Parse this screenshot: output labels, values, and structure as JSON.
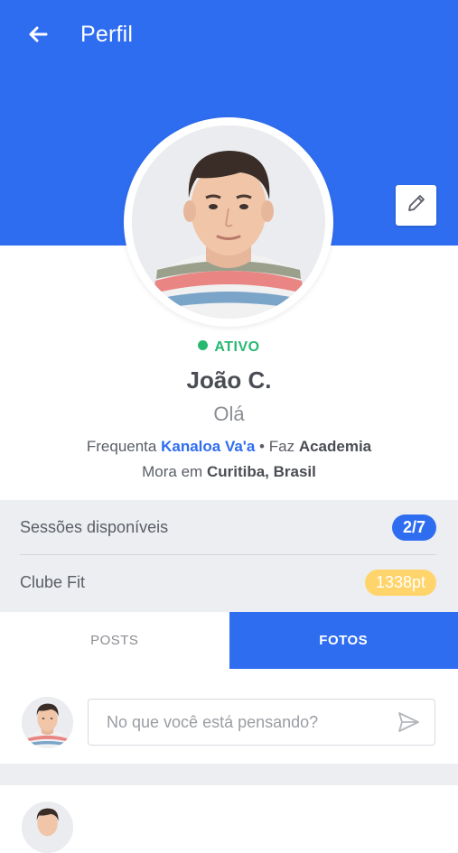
{
  "header": {
    "title": "Perfil",
    "back_icon": "arrow-left-icon",
    "edit_icon": "pencil-icon",
    "bg_color": "#2f6df0"
  },
  "profile": {
    "status": "ATIVO",
    "status_color": "#27b872",
    "name": "João C.",
    "greeting": "Olá",
    "line1": {
      "prefix": "Frequenta",
      "gym": "Kanaloa Va'a",
      "separator": "•",
      "activity_prefix": "Faz",
      "activity": "Academia"
    },
    "line2": {
      "prefix": "Mora em",
      "location": "Curitiba, Brasil"
    }
  },
  "stats": {
    "sessions_label": "Sessões disponíveis",
    "sessions_value": "2/7",
    "club_label": "Clube Fit",
    "club_value": "1338pt"
  },
  "tabs": [
    {
      "label": "POSTS",
      "active": false
    },
    {
      "label": "FOTOS",
      "active": true
    }
  ],
  "composer": {
    "placeholder": "No que você está pensando?",
    "send_icon": "send-icon"
  }
}
